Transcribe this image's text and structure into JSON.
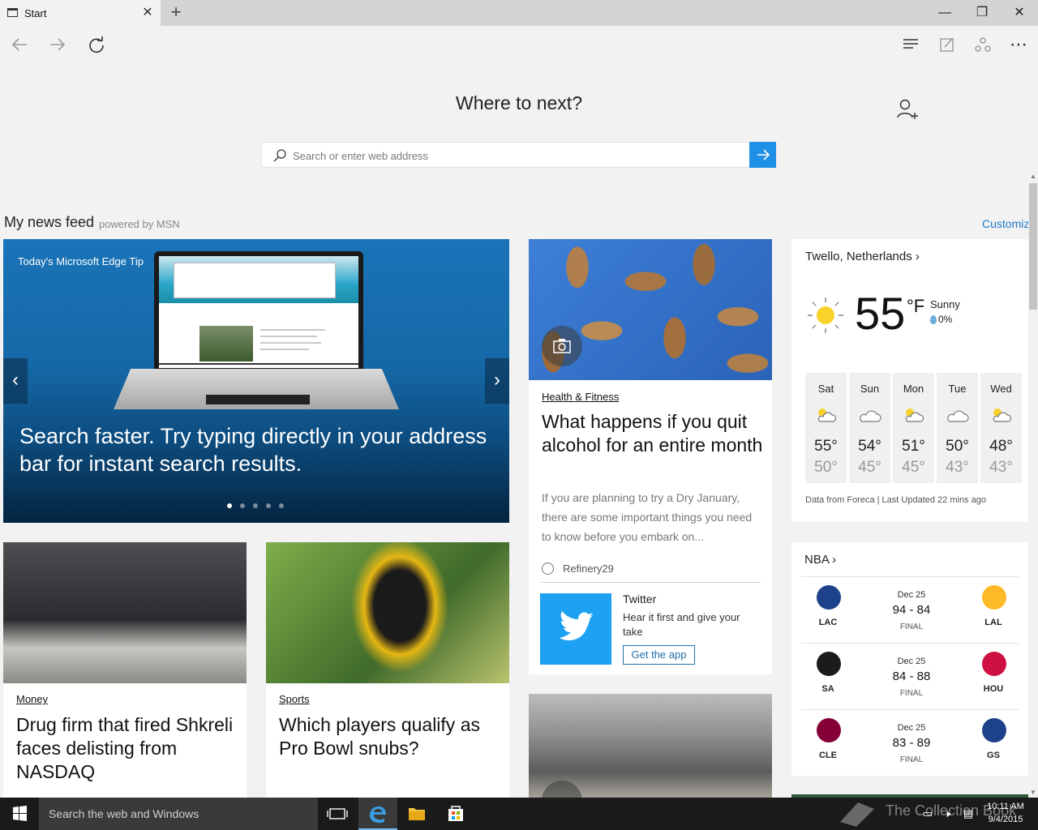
{
  "tab": {
    "title": "Start"
  },
  "window_controls": {
    "minimize": "—",
    "restore": "❐",
    "close": "✕"
  },
  "start_page": {
    "heading": "Where to next?",
    "search_placeholder": "Search or enter web address"
  },
  "feed": {
    "title": "My news feed",
    "powered_by": "powered by MSN",
    "customize": "Customize"
  },
  "hero": {
    "badge": "Today's Microsoft Edge Tip",
    "headline": "Search faster. Try typing directly in your address bar for instant search results.",
    "slide_count": 5,
    "active_slide": 1
  },
  "articles": {
    "alcohol": {
      "category": "Health & Fitness",
      "title": "What happens if you quit alcohol for an entire month",
      "description": "If you are planning to try a Dry January, there are some important things you need to know before you embark on...",
      "source": "Refinery29"
    },
    "money": {
      "category": "Money",
      "title": "Drug firm that fired Shkreli faces delisting from NASDAQ"
    },
    "sports": {
      "category": "Sports",
      "title": "Which players qualify as Pro Bowl snubs?"
    }
  },
  "twitter": {
    "name": "Twitter",
    "description": "Hear it first and give your take",
    "button": "Get the app",
    "brand_color": "#1da1f2"
  },
  "weather": {
    "location": "Twello, Netherlands",
    "temperature": "55",
    "unit": "°F",
    "condition": "Sunny",
    "precipitation": "0%",
    "forecast": [
      {
        "day": "Sat",
        "high": "55°",
        "low": "50°",
        "icon": "partly-sunny-icon"
      },
      {
        "day": "Sun",
        "high": "54°",
        "low": "45°",
        "icon": "cloudy-icon"
      },
      {
        "day": "Mon",
        "high": "51°",
        "low": "45°",
        "icon": "partly-sunny-icon"
      },
      {
        "day": "Tue",
        "high": "50°",
        "low": "43°",
        "icon": "cloudy-icon"
      },
      {
        "day": "Wed",
        "high": "48°",
        "low": "43°",
        "icon": "partly-sunny-icon"
      }
    ],
    "footer": "Data from Foreca | Last Updated 22 mins ago"
  },
  "nba": {
    "title": "NBA",
    "games": [
      {
        "home": "LAC",
        "away": "LAL",
        "date": "Dec 25",
        "score": "94 - 84",
        "status": "FINAL",
        "home_color": "#1d428a",
        "away_color": "#fdb927"
      },
      {
        "home": "SA",
        "away": "HOU",
        "date": "Dec 25",
        "score": "84 - 88",
        "status": "FINAL",
        "home_color": "#1b1b1b",
        "away_color": "#ce1141"
      },
      {
        "home": "CLE",
        "away": "GS",
        "date": "Dec 25",
        "score": "83 - 89",
        "status": "FINAL",
        "home_color": "#860038",
        "away_color": "#1d428a"
      }
    ]
  },
  "taskbar": {
    "search_placeholder": "Search the web and Windows",
    "time": "10:11 AM",
    "date": "9/4/2015",
    "watermark": "The Collection Book"
  },
  "colors": {
    "accent": "#1e90e6",
    "link": "#1f7ac7"
  }
}
